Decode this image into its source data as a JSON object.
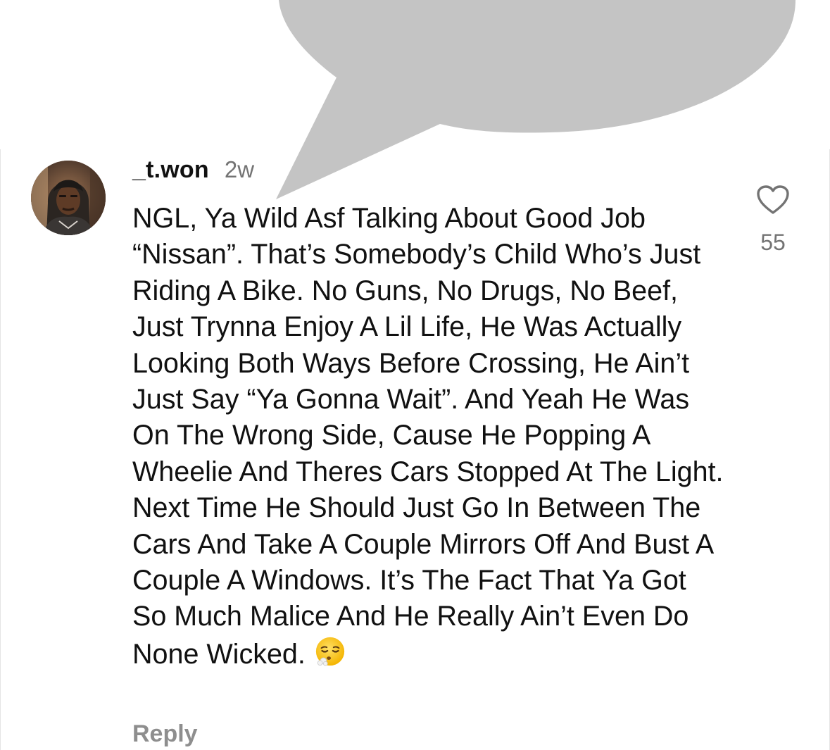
{
  "comment": {
    "username": "_t.won",
    "time_ago": "2w",
    "text": "NGL, Ya Wild Asf Talking About Good Job “Nissan”. That’s Somebody’s Child Who’s Just Riding A Bike. No Guns, No Drugs, No Beef, Just Trynna Enjoy A Lil Life, He Was Actually Looking Both Ways Before Crossing, He Ain’t Just Say “Ya Gonna Wait”. And Yeah He Was On The Wrong Side, Cause He Popping A Wheelie And Theres Cars Stopped At The Light. Next Time He Should Just Go In Between The Cars And Take A Couple Mirrors Off And Bust A Couple A Windows. It’s The Fact That Ya Got So Much Malice And He Really Ain’t Even Do None Wicked.",
    "emoji": "face-exhaling-emoji",
    "reply_label": "Reply",
    "like_count": "55",
    "like_icon": "heart-icon"
  },
  "colors": {
    "bubble": "#c4c4c4",
    "text": "#111111",
    "muted": "#737373",
    "reply": "#8e8e8e"
  }
}
